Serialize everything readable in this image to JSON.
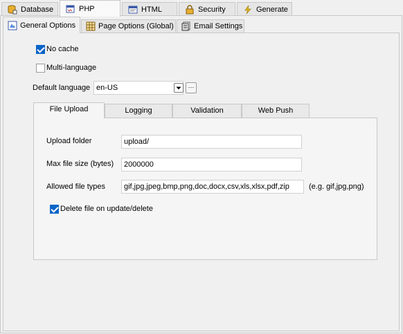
{
  "top_tabs": [
    {
      "label": "Database",
      "icon": "database-icon"
    },
    {
      "label": "PHP",
      "icon": "php-icon"
    },
    {
      "label": "HTML",
      "icon": "html-icon"
    },
    {
      "label": "Security",
      "icon": "lock-icon"
    },
    {
      "label": "Generate",
      "icon": "lightning-icon"
    }
  ],
  "active_top_tab": "PHP",
  "sub_tabs": [
    {
      "label": "General Options",
      "icon": "general-options-icon"
    },
    {
      "label": "Page Options (Global)",
      "icon": "grid-icon"
    },
    {
      "label": "Email Settings",
      "icon": "email-icon"
    }
  ],
  "active_sub_tab": "General Options",
  "general": {
    "no_cache_label": "No cache",
    "no_cache_checked": true,
    "multi_language_label": "Multi-language",
    "multi_language_checked": false,
    "default_language_label": "Default language",
    "default_language_value": "en-US",
    "more_button_label": "···"
  },
  "group_tabs": [
    "File Upload",
    "Logging",
    "Validation",
    "Web Push"
  ],
  "active_group_tab": "File Upload",
  "file_upload": {
    "upload_folder_label": "Upload folder",
    "upload_folder_value": "upload/",
    "max_file_size_label": "Max file size (bytes)",
    "max_file_size_value": "2000000",
    "allowed_types_label": "Allowed file types",
    "allowed_types_value": "gif,jpg,jpeg,bmp,png,doc,docx,csv,xls,xlsx,pdf,zip",
    "allowed_types_hint": "(e.g. gif,jpg,png)",
    "delete_file_label": "Delete file on update/delete",
    "delete_file_checked": true
  },
  "colors": {
    "accent": "#0a64c8"
  }
}
